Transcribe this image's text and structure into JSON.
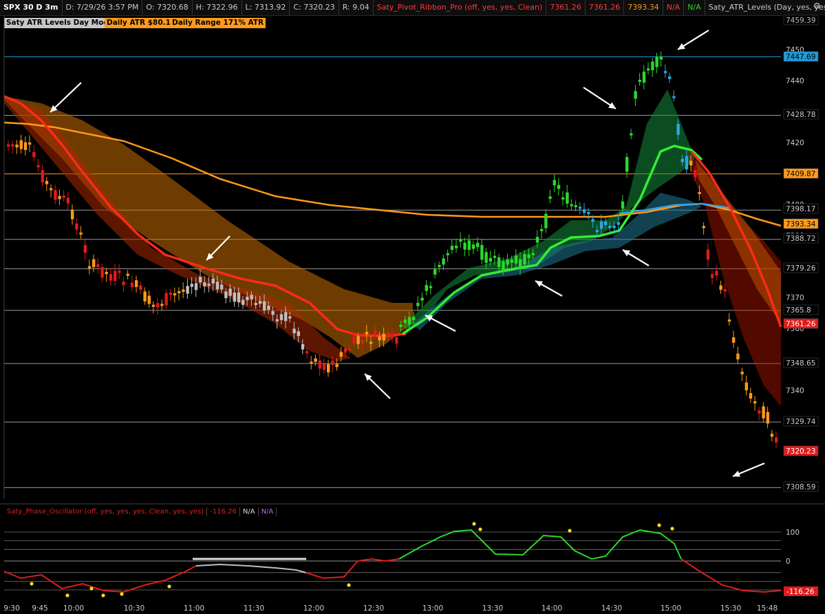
{
  "header": {
    "symbol": "SPX 30 D 3m",
    "date": "D: 7/29/26 3:57 PM",
    "open": "O: 7320.68",
    "high": "H: 7322.96",
    "low": "L: 7313.92",
    "close": "C: 7320.23",
    "range": "R: 9.04",
    "ribbon_study": "Saty_Pivot_Ribbon_Pro (off, yes, yes, Clean)",
    "ribbon_v1": "7361.26",
    "ribbon_v2": "7361.26",
    "ribbon_v3": "7393.34",
    "na_red": "N/A",
    "na_green": "N/A",
    "atr_study": "Saty_ATR_Levels (Day, yes, yes, 14, no,..."
  },
  "labels": {
    "mode": "Saty ATR Levels Day Mode",
    "daily_atr": "Daily ATR $80.13",
    "daily_range": "Daily Range 171% ATR"
  },
  "price_axis": {
    "ticks": [
      "7450",
      "7440",
      "7420",
      "7410",
      "7400",
      "7390",
      "7380",
      "7370",
      "7360",
      "7340",
      "7330"
    ],
    "tags": [
      {
        "value": "7459.39",
        "bg": "#000000",
        "fg": "#bbbbbb"
      },
      {
        "value": "7447.69",
        "bg": "#1e9bd7",
        "fg": "#000000"
      },
      {
        "value": "7428.78",
        "bg": "#000000",
        "fg": "#cccccc"
      },
      {
        "value": "7409.87",
        "bg": "#ff9a1a",
        "fg": "#000000"
      },
      {
        "value": "7398.17",
        "bg": "#000000",
        "fg": "#cccccc"
      },
      {
        "value": "7393.34",
        "bg": "#ff9a1a",
        "fg": "#000000"
      },
      {
        "value": "7388.72",
        "bg": "#000000",
        "fg": "#cccccc"
      },
      {
        "value": "7379.26",
        "bg": "#000000",
        "fg": "#cccccc"
      },
      {
        "value": "7365.8",
        "bg": "#000000",
        "fg": "#cccccc"
      },
      {
        "value": "7361.26",
        "bg": "#e01b1b",
        "fg": "#ffffff"
      },
      {
        "value": "7348.65",
        "bg": "#000000",
        "fg": "#cccccc"
      },
      {
        "value": "7329.74",
        "bg": "#000000",
        "fg": "#cccccc"
      },
      {
        "value": "7320.23",
        "bg": "#e01b1b",
        "fg": "#ffffff"
      },
      {
        "value": "7308.59",
        "bg": "#000000",
        "fg": "#cccccc"
      }
    ]
  },
  "oscillator": {
    "name": "Saty_Phase_Oscillator (off, yes, yes, yes, Clean, yes, yes)",
    "value": "-116.26",
    "na1": "N/A",
    "na2": "N/A",
    "ticks": [
      "100",
      "0",
      "-100"
    ],
    "current_tag": "-116.26"
  },
  "time_axis": [
    "9:30",
    "9:45",
    "10:00",
    "10:30",
    "11:00",
    "11:30",
    "12:00",
    "12:30",
    "13:00",
    "13:30",
    "14:00",
    "14:30",
    "15:00",
    "15:30",
    "15:48"
  ],
  "colors": {
    "up_green": "#2bd92b",
    "down_red": "#e01b1b",
    "orange": "#ff9a1a",
    "cyan": "#1e9bd7",
    "gray_bar": "#bfbfbf"
  }
}
